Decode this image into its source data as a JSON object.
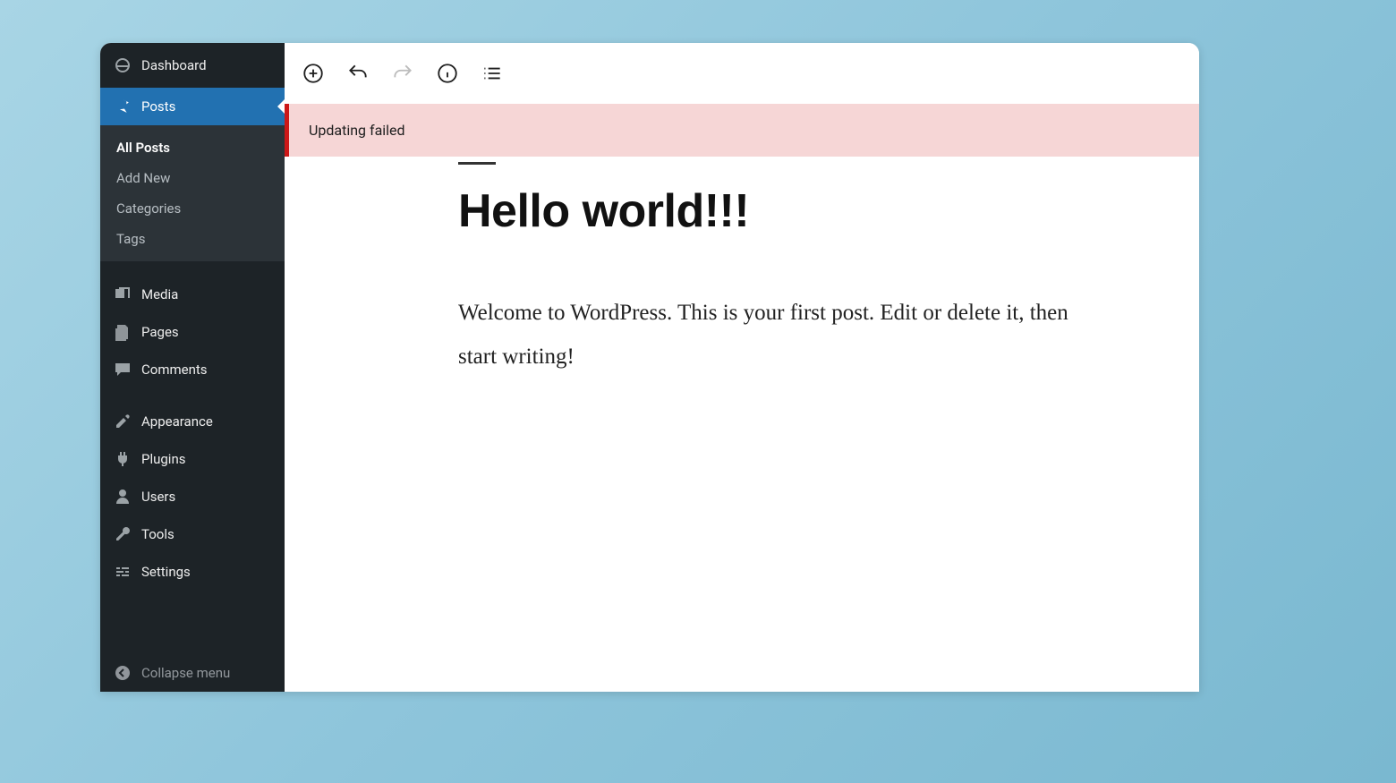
{
  "sidebar": {
    "dashboard": "Dashboard",
    "posts": "Posts",
    "posts_sub": {
      "all": "All Posts",
      "add": "Add New",
      "categories": "Categories",
      "tags": "Tags"
    },
    "media": "Media",
    "pages": "Pages",
    "comments": "Comments",
    "appearance": "Appearance",
    "plugins": "Plugins",
    "users": "Users",
    "tools": "Tools",
    "settings": "Settings",
    "collapse": "Collapse menu"
  },
  "notice": {
    "message": "Updating failed"
  },
  "post": {
    "title": "Hello world!!!",
    "body": "Welcome to WordPress. This is your first post. Edit or delete it, then start writing!"
  }
}
